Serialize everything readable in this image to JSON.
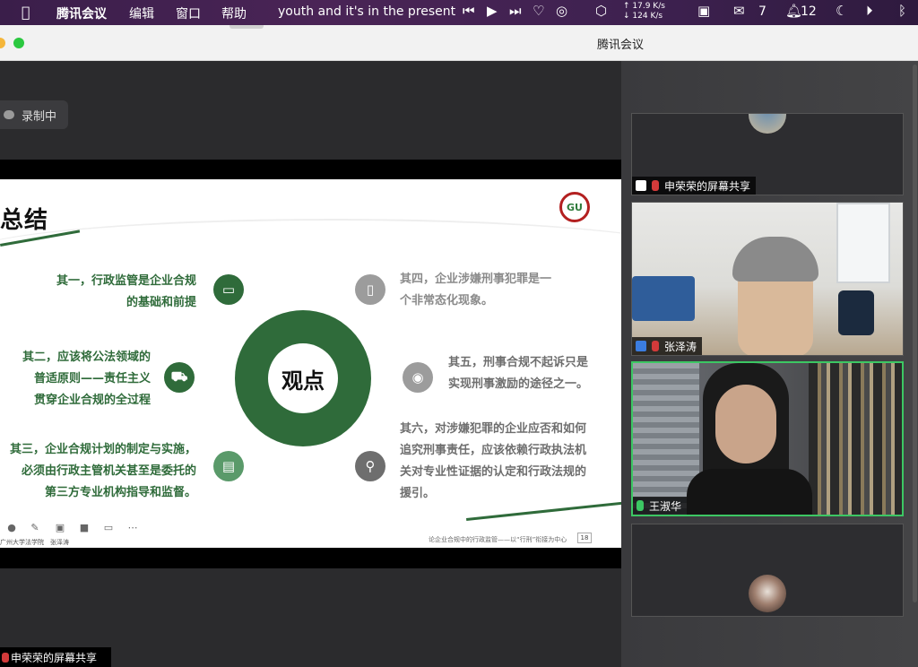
{
  "menubar": {
    "app_name": "腾讯会议",
    "menu_items": [
      "编辑",
      "窗口",
      "帮助"
    ],
    "now_playing": "youth and it's in the present",
    "net_up": "↑ 17.9 K/s",
    "net_down": "↓ 124 K/s",
    "wechat_count": "7",
    "notif_count": "12"
  },
  "window": {
    "title": "腾讯会议"
  },
  "recording": {
    "label": "录制中"
  },
  "slide": {
    "title": "总结",
    "logo_text": "GU",
    "center_label": "观点",
    "points_left": [
      {
        "lines": [
          "其一，行政监管是企业合规",
          "的基础和前提"
        ]
      },
      {
        "lines": [
          "其二，应该将公法领域的",
          "普适原则——责任主义",
          "贯穿企业合规的全过程"
        ]
      },
      {
        "lines": [
          "其三，企业合规计划的制定与实施，",
          "必须由行政主管机关甚至是委托的",
          "第三方专业机构指导和监督。"
        ]
      }
    ],
    "points_right": [
      {
        "lines": [
          "其四，企业涉嫌刑事犯罪是一",
          "个非常态化现象。"
        ]
      },
      {
        "lines": [
          "其五，刑事合规不起诉只是",
          "实现刑事激励的途径之一。"
        ]
      },
      {
        "lines": [
          "其六，对涉嫌犯罪的企业应否和如何",
          "追究刑事责任，应该依赖行政执法机",
          "关对专业性证据的认定和行政法规的",
          "援引。"
        ]
      }
    ],
    "footer_left_1": "广州大学法学院",
    "footer_left_2": "张泽涛",
    "footer_center": "论企业合规中的行政监管——以“行刑”衔接为中心",
    "page_number": "18"
  },
  "share_label": "申荣荣的屏幕共享",
  "participants": [
    {
      "name": "申荣荣的屏幕共享"
    },
    {
      "name": "张泽涛"
    },
    {
      "name": "王淑华"
    },
    {
      "name": ""
    }
  ],
  "colors": {
    "slide_green": "#2f6b3a",
    "speaking_border": "#3cc763",
    "mic_muted": "#d23a3a"
  }
}
